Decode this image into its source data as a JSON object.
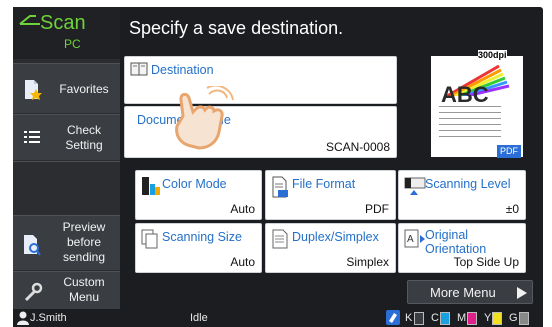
{
  "app": {
    "title": "Scan",
    "subtitle": "PC"
  },
  "sidebar": {
    "items": [
      {
        "label": "Favorites"
      },
      {
        "label": "Check\nSetting"
      },
      {
        "label": "Preview\nbefore\nsending"
      },
      {
        "label": "Custom\nMenu"
      }
    ]
  },
  "header": {
    "title": "Specify a save destination."
  },
  "destination": {
    "label": "Destination"
  },
  "docname": {
    "label": "Document Name",
    "value": "SCAN-0008"
  },
  "settings": [
    {
      "label": "Color Mode",
      "value": "Auto"
    },
    {
      "label": "File Format",
      "value": "PDF"
    },
    {
      "label": "Scanning Level",
      "value": "±0"
    },
    {
      "label": "Scanning Size",
      "value": "Auto"
    },
    {
      "label": "Duplex/Simplex",
      "value": "Simplex"
    },
    {
      "label": "Original\nOrientation",
      "value": "Top Side Up"
    }
  ],
  "preview": {
    "dpi": "300dpi",
    "text": "ABC",
    "format_badge": "PDF"
  },
  "more_menu": {
    "label": "More Menu"
  },
  "status": {
    "user": "J.Smith",
    "state": "Idle",
    "toner_labels": [
      "K",
      "C",
      "M",
      "Y",
      "G"
    ],
    "toner_colors": [
      "#222222",
      "#1aa0e0",
      "#e0208a",
      "#f0e020",
      "#888888"
    ]
  }
}
